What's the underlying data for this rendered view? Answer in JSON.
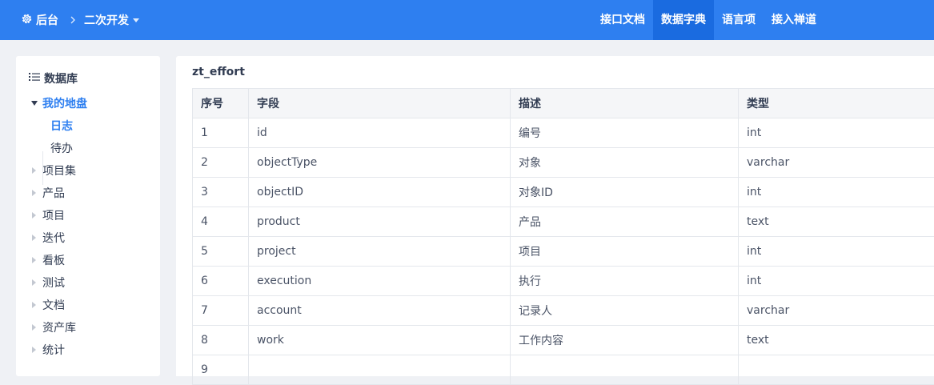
{
  "topbar": {
    "home_label": "后台",
    "crumb_label": "二次开发",
    "nav": [
      {
        "label": "接口文档",
        "active": false
      },
      {
        "label": "数据字典",
        "active": true
      },
      {
        "label": "语言项",
        "active": false
      },
      {
        "label": "接入禅道",
        "active": false
      }
    ],
    "colors": {
      "bar": "#2e7ff0",
      "active": "#1a6be0"
    }
  },
  "sidebar": {
    "title": "数据库",
    "tree": [
      {
        "label": "我的地盘",
        "expanded": true
      },
      {
        "label": "日志",
        "selected": true
      },
      {
        "label": "待办"
      },
      {
        "label": "项目集"
      },
      {
        "label": "产品"
      },
      {
        "label": "项目"
      },
      {
        "label": "迭代"
      },
      {
        "label": "看板"
      },
      {
        "label": "测试"
      },
      {
        "label": "文档"
      },
      {
        "label": "资产库"
      },
      {
        "label": "统计"
      }
    ]
  },
  "main": {
    "table_name": "zt_effort",
    "columns": [
      "序号",
      "字段",
      "描述",
      "类型"
    ],
    "rows": [
      [
        "1",
        "id",
        "编号",
        "int"
      ],
      [
        "2",
        "objectType",
        "对象",
        "varchar"
      ],
      [
        "3",
        "objectID",
        "对象ID",
        "int"
      ],
      [
        "4",
        "product",
        "产品",
        "text"
      ],
      [
        "5",
        "project",
        "项目",
        "int"
      ],
      [
        "6",
        "execution",
        "执行",
        "int"
      ],
      [
        "7",
        "account",
        "记录人",
        "varchar"
      ],
      [
        "8",
        "work",
        "工作内容",
        "text"
      ],
      [
        "9",
        "",
        "",
        ""
      ]
    ]
  }
}
